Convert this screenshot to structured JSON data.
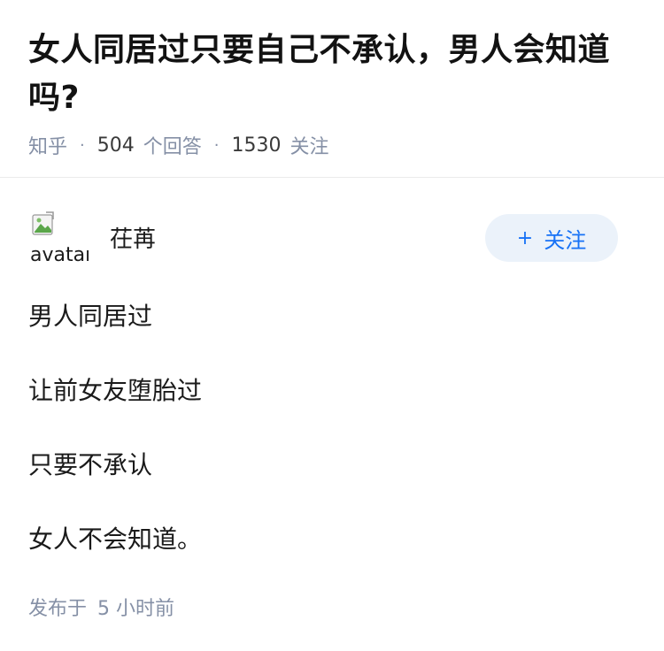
{
  "question": {
    "title": "女人同居过只要自己不承认，男人会知道吗?",
    "source": "知乎",
    "answer_count": "504",
    "answer_label": "个回答",
    "follower_count": "1530",
    "follower_label": "关注"
  },
  "author": {
    "avatar_alt": "avatar",
    "name": "茌苒",
    "follow_label": "关注",
    "follow_icon": "plus-icon"
  },
  "answer": {
    "lines": [
      "男人同居过",
      "让前女友堕胎过",
      "只要不承认",
      "女人不会知道。"
    ],
    "publish_prefix": "发布于",
    "publish_time": "5 小时前"
  },
  "colors": {
    "accent": "#1772f6",
    "follow_bg": "#ebf2fa",
    "meta": "#8590a6"
  }
}
